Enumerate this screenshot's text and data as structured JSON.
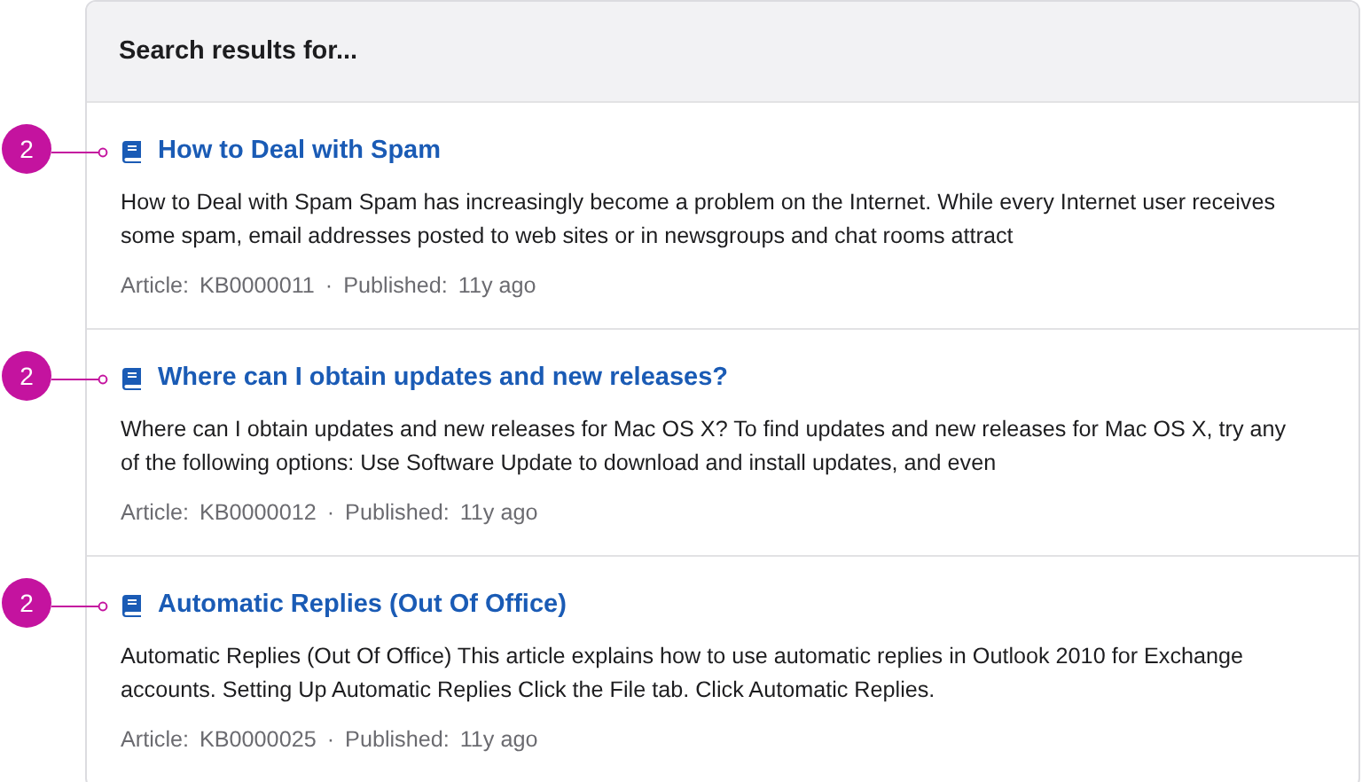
{
  "header": {
    "title": "Search results for..."
  },
  "results": [
    {
      "callout": "2",
      "title": "How to Deal with Spam",
      "snippet": "How to Deal with Spam Spam has increasingly become a problem on the Internet. While every Internet user receives some spam, email addresses posted to web sites or in newsgroups and chat rooms attract",
      "type_label": "Article:",
      "number": "KB0000011",
      "separator": "·",
      "published_label": "Published:",
      "published": "11y ago"
    },
    {
      "callout": "2",
      "title": "Where can I obtain updates and new releases?",
      "snippet": "Where can I obtain updates and new releases for Mac OS X? To find updates and new releases for Mac OS X, try any of the following options: Use Software Update to download and install updates, and even",
      "type_label": "Article:",
      "number": "KB0000012",
      "separator": "·",
      "published_label": "Published:",
      "published": "11y ago"
    },
    {
      "callout": "2",
      "title": "Automatic Replies (Out Of Office)",
      "snippet": "Automatic Replies (Out Of Office) This article explains how to use automatic replies in Outlook 2010 for Exchange accounts. Setting Up Automatic Replies Click the File tab. Click Automatic Replies.",
      "type_label": "Article:",
      "number": "KB0000025",
      "separator": "·",
      "published_label": "Published:",
      "published": "11y ago"
    }
  ]
}
